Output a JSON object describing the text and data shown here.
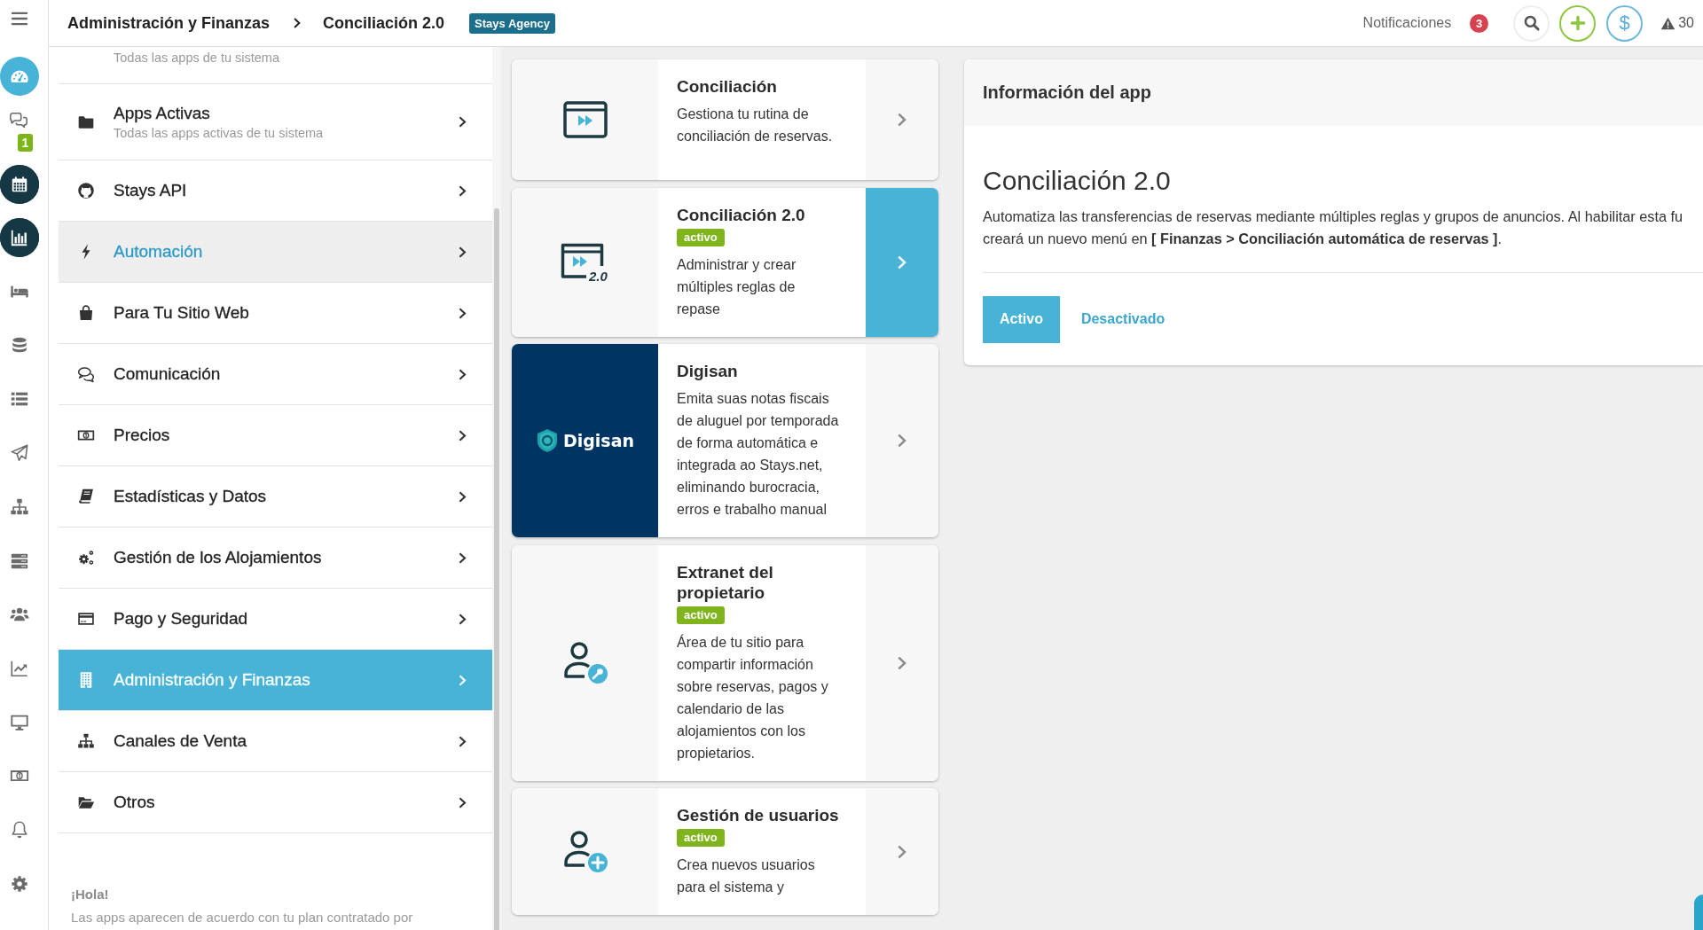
{
  "rail": {
    "items": [
      {
        "selected": true,
        "emphasized": false
      },
      {
        "selected": false,
        "emphasized": false,
        "badge": "1"
      },
      {
        "selected": false,
        "emphasized": true
      },
      {
        "selected": false,
        "emphasized": true
      },
      {
        "selected": false,
        "emphasized": false
      },
      {
        "selected": false,
        "emphasized": false
      },
      {
        "selected": false,
        "emphasized": false
      },
      {
        "selected": false,
        "emphasized": false
      },
      {
        "selected": false,
        "emphasized": false
      },
      {
        "selected": false,
        "emphasized": false
      },
      {
        "selected": false,
        "emphasized": false
      },
      {
        "selected": false,
        "emphasized": false
      },
      {
        "selected": false,
        "emphasized": false
      },
      {
        "selected": false,
        "emphasized": false
      },
      {
        "selected": false,
        "emphasized": false
      },
      {
        "selected": false,
        "emphasized": false
      }
    ]
  },
  "topbar": {
    "breadcrumb": [
      "Administración y Finanzas",
      "Conciliación 2.0"
    ],
    "account_badge": "Stays Agency",
    "notifications_label": "Notificaciones",
    "notifications_count": "3",
    "money_symbol": "$",
    "warnings_count": "30"
  },
  "menu": {
    "items": [
      {
        "subtitle": "Todas las apps de tu sistema",
        "selected": false,
        "highlighted": false
      },
      {
        "title": "Apps Activas",
        "subtitle": "Todas las apps activas de tu sistema",
        "selected": false,
        "highlighted": false
      },
      {
        "title": "Stays API",
        "selected": false,
        "highlighted": false
      },
      {
        "title": "Automación",
        "selected": false,
        "highlighted": true
      },
      {
        "title": "Para Tu Sitio Web",
        "selected": false,
        "highlighted": false
      },
      {
        "title": "Comunicación",
        "selected": false,
        "highlighted": false
      },
      {
        "title": "Precios",
        "selected": false,
        "highlighted": false
      },
      {
        "title": "Estadísticas y Datos",
        "selected": false,
        "highlighted": false
      },
      {
        "title": "Gestión de los Alojamientos",
        "selected": false,
        "highlighted": false
      },
      {
        "title": "Pago y Seguridad",
        "selected": false,
        "highlighted": false
      },
      {
        "title": "Administración y Finanzas",
        "selected": true,
        "highlighted": false
      },
      {
        "title": "Canales de Venta",
        "selected": false,
        "highlighted": false
      },
      {
        "title": "Otros",
        "selected": false,
        "highlighted": false
      }
    ],
    "note": {
      "title": "¡Hola!",
      "text": "Las apps aparecen de acuerdo con tu plan contratado por"
    }
  },
  "apps": [
    {
      "kind": "icon",
      "title": "Conciliación",
      "description": "Gestiona tu rutina de conciliación de reservas.",
      "selected": false
    },
    {
      "kind": "icon",
      "icon_label": "2.0",
      "title": "Conciliación 2.0",
      "badge": "activo",
      "description": "Administrar y crear múltiples reglas de repase",
      "selected": true
    },
    {
      "kind": "logo",
      "logo_text": "Digisan",
      "title": "Digisan",
      "description": "Emita suas notas fiscais de aluguel por temporada de forma automática e integrada ao Stays.net, eliminando burocracia, erros e trabalho manual",
      "selected": false
    },
    {
      "kind": "icon",
      "title": "Extranet del propietario",
      "badge": "activo",
      "description": "Área de tu sitio para compartir información sobre reservas, pagos y calendario de las alojamientos con los propietarios.",
      "selected": false
    },
    {
      "kind": "icon",
      "title": "Gestión de usuarios",
      "badge": "activo",
      "description": "Crea nuevos usuarios para el sistema y",
      "selected": false
    }
  ],
  "info_panel": {
    "header": "Información del app",
    "title": "Conciliación 2.0",
    "description": "Automatiza las transferencias de reservas mediante múltiples reglas y grupos de anuncios. Al habilitar esta fu\ncreará un nuevo menú en **[ Finanzas > Conciliación automática de reservas ]**.",
    "options": [
      {
        "label": "Activo",
        "selected": true
      },
      {
        "label": "Desactivado",
        "selected": false
      }
    ]
  }
}
